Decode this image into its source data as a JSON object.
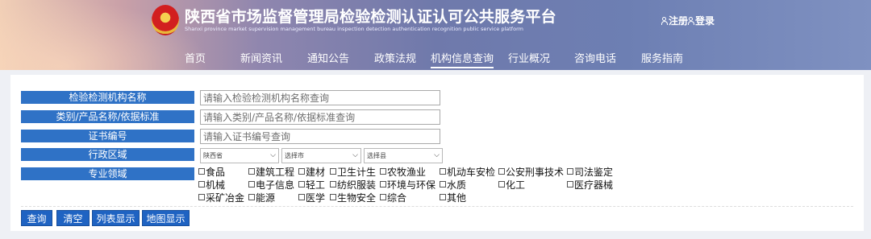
{
  "site": {
    "title": "陕西省市场监督管理局检验检测认证认可公共服务平台",
    "subtitle": "Shanxi province market supervision management bureau inspection detection authentication recognition public service platform",
    "register": "注册",
    "login": "登录"
  },
  "nav": [
    "首页",
    "新闻资讯",
    "通知公告",
    "政策法规",
    "机构信息查询",
    "行业概况",
    "咨询电话",
    "服务指南"
  ],
  "search": {
    "org_name": {
      "label": "检验检测机构名称",
      "placeholder": "请输入检验检测机构名称查询"
    },
    "category": {
      "label": "类别/产品名称/依据标准",
      "placeholder": "请输入类别/产品名称/依据标准查询"
    },
    "cert_no": {
      "label": "证书编号",
      "placeholder": "请输入证书编号查询"
    },
    "region": {
      "label": "行政区域",
      "province": "陕西省",
      "city": "选择市",
      "county": "选择县"
    },
    "domain": {
      "label": "专业领域",
      "options": [
        "食品",
        "建筑工程",
        "建材",
        "卫生计生",
        "农牧渔业",
        "机动车安检",
        "公安刑事技术",
        "司法鉴定",
        "机械",
        "电子信息",
        "轻工",
        "纺织服装",
        "环境与环保",
        "水质",
        "化工",
        "医疗器械",
        "采矿冶金",
        "能源",
        "医学",
        "生物安全",
        "综合",
        "其他"
      ]
    }
  },
  "buttons": {
    "query": "查询",
    "clear": "清空",
    "list": "列表显示",
    "map": "地图显示"
  },
  "colors": {
    "label_bg": "#2f72c6",
    "button_bg": "#1f63c2",
    "page_bg": "#eef0f5"
  }
}
